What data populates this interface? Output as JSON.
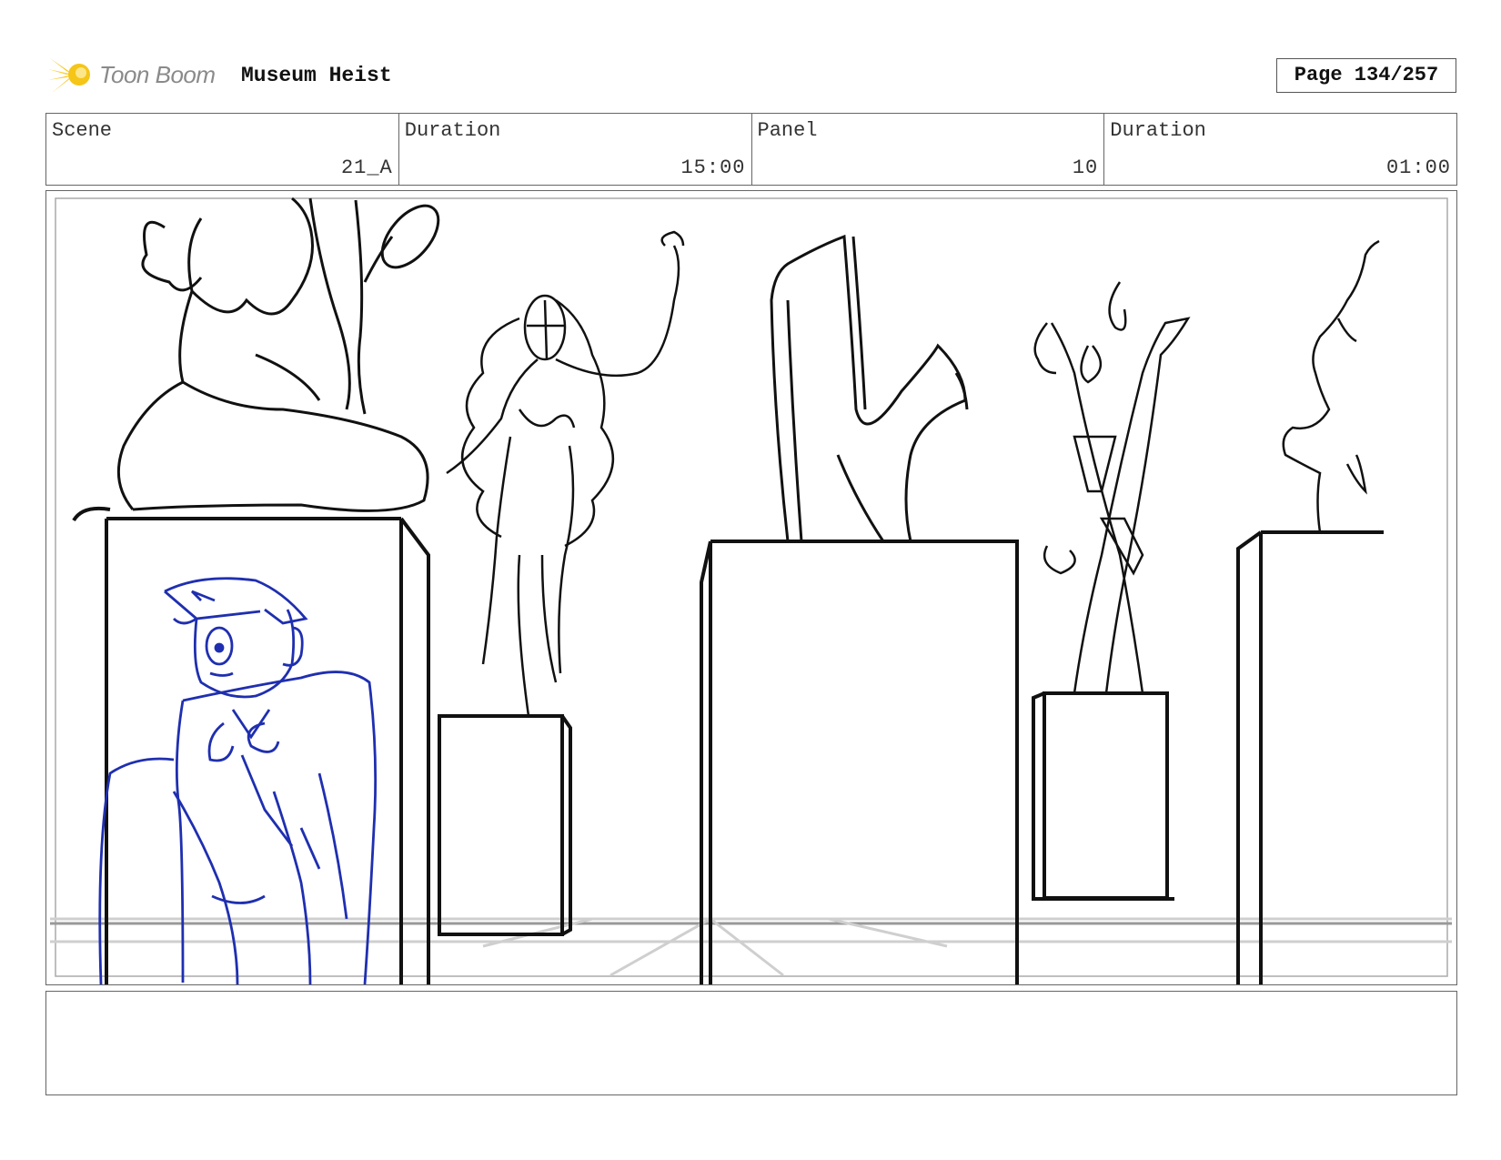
{
  "header": {
    "logo_text": "Toon Boom",
    "project_title": "Museum Heist",
    "page_label": "Page 134/257"
  },
  "info": {
    "scene_label": "Scene",
    "scene_value": "21_A",
    "scene_duration_label": "Duration",
    "scene_duration_value": "15:00",
    "panel_label": "Panel",
    "panel_value": "10",
    "panel_duration_label": "Duration",
    "panel_duration_value": "01:00"
  },
  "panel": {
    "sketch_colors": {
      "ink": "#111111",
      "character": "#1f2fb0",
      "floor_guides": "#cfcfcf"
    }
  },
  "notes": {
    "text": ""
  },
  "colors": {
    "logo_accent": "#f5c518",
    "border": "#666666"
  }
}
